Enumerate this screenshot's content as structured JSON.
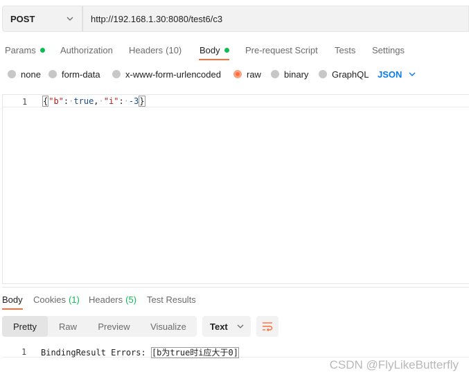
{
  "request": {
    "method": "POST",
    "url": "http://192.168.1.30:8080/test6/c3"
  },
  "request_tabs": [
    {
      "label": "Params",
      "indicator": "green-dot"
    },
    {
      "label": "Authorization"
    },
    {
      "label": "Headers",
      "count": "(10)"
    },
    {
      "label": "Body",
      "indicator": "green-dot",
      "active": true
    },
    {
      "label": "Pre-request Script"
    },
    {
      "label": "Tests"
    },
    {
      "label": "Settings"
    }
  ],
  "body_types": {
    "options": [
      "none",
      "form-data",
      "x-www-form-urlencoded",
      "raw",
      "binary",
      "GraphQL"
    ],
    "selected": "raw",
    "format": "JSON"
  },
  "editor": {
    "line_number": "1",
    "tokens": {
      "open": "{",
      "key_b": "\"b\"",
      "colon1": ":",
      "ws1": "·",
      "val_b": "true",
      "comma": ",",
      "ws2": "·",
      "key_i": "\"i\"",
      "colon2": ":",
      "ws3": "·",
      "val_i": "-3",
      "close": "}"
    }
  },
  "response_tabs": [
    {
      "label": "Body",
      "active": true
    },
    {
      "label": "Cookies",
      "count": "(1)"
    },
    {
      "label": "Headers",
      "count": "(5)"
    },
    {
      "label": "Test Results"
    }
  ],
  "response_view": {
    "modes": [
      "Pretty",
      "Raw",
      "Preview",
      "Visualize"
    ],
    "active_mode": "Pretty",
    "format": "Text"
  },
  "response_body": {
    "line_number": "1",
    "prefix": "BindingResult Errors: ",
    "highlight": "[b为true时i应大于0]"
  },
  "watermark": "CSDN @FlyLikeButterfly",
  "colors": {
    "accent": "#ff6c37",
    "indicator_green": "#0cbb52",
    "json_blue": "#097bed"
  }
}
